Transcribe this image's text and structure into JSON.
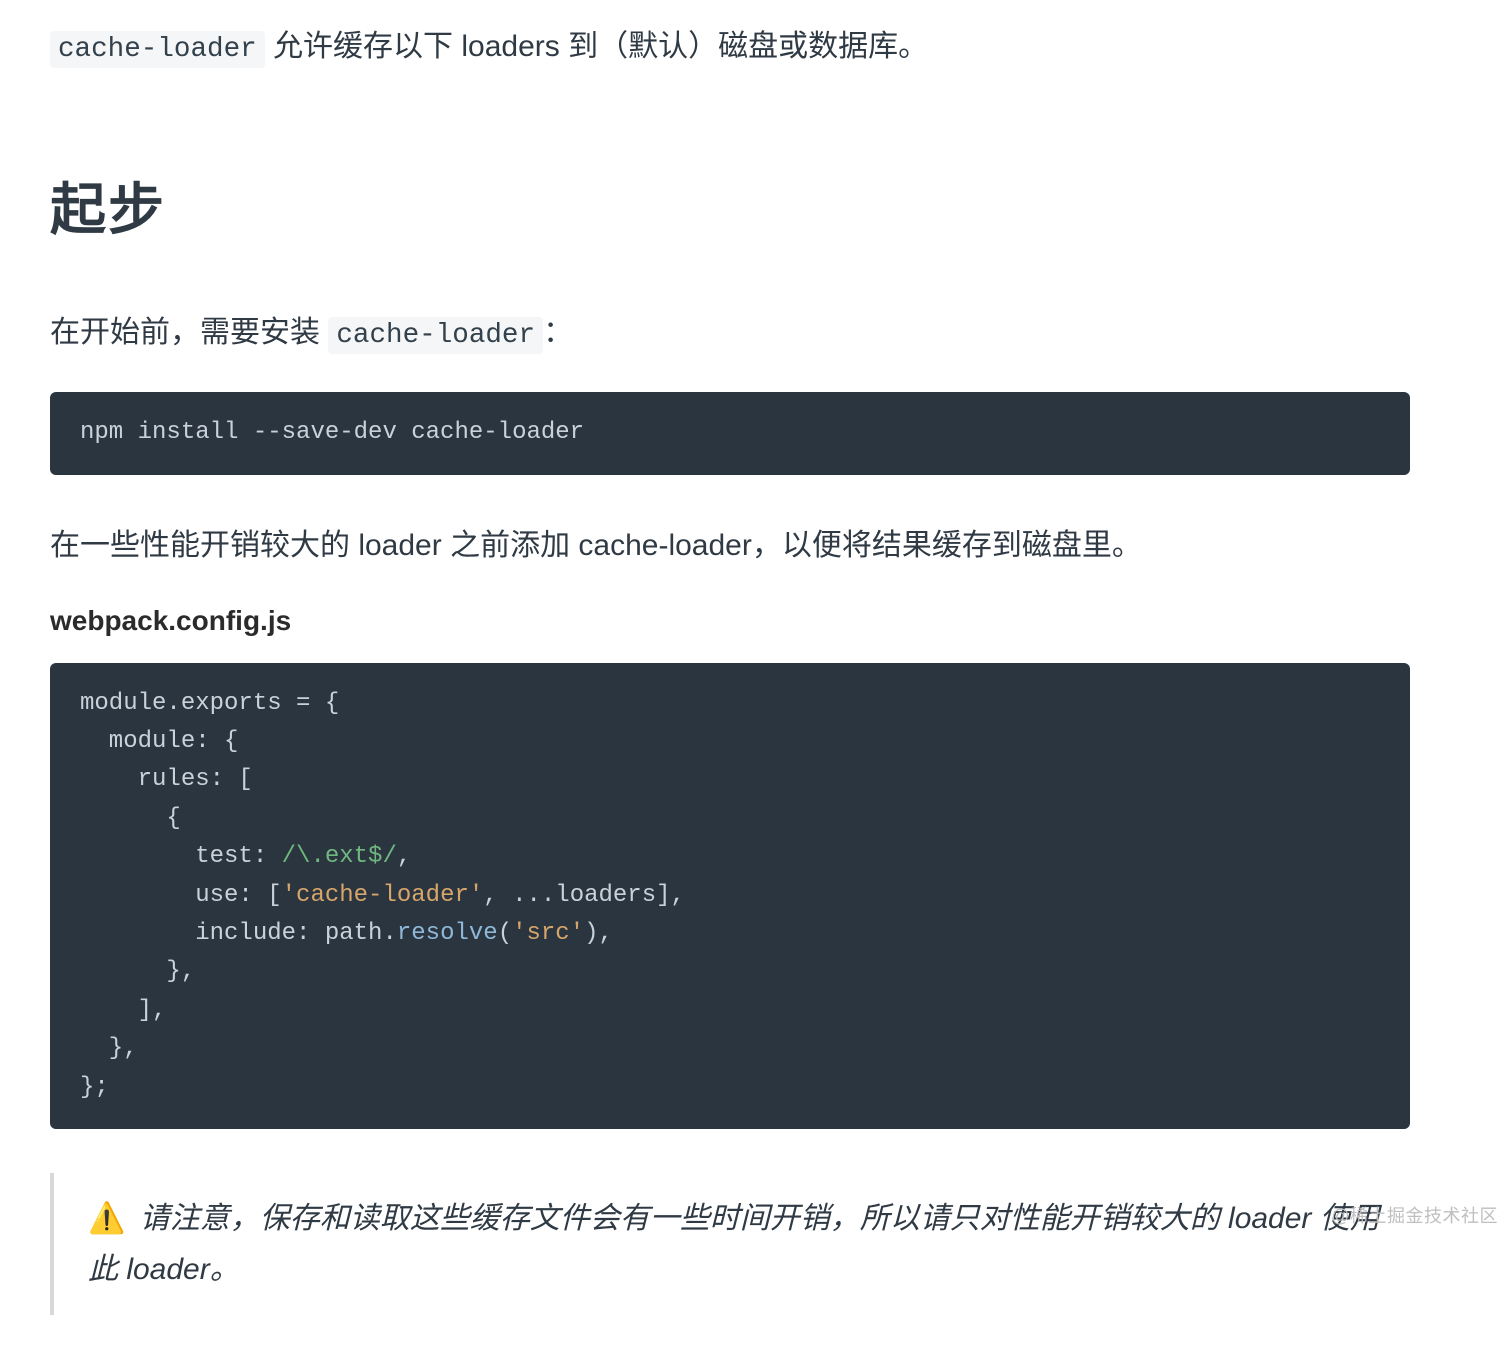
{
  "intro": {
    "code": "cache-loader",
    "rest": " 允许缓存以下 loaders 到（默认）磁盘或数据库。"
  },
  "heading": "起步",
  "before_install": {
    "prefix": "在开始前，需要安装 ",
    "code": "cache-loader",
    "suffix": "："
  },
  "install_cmd": "npm install --save-dev cache-loader",
  "after_install": "在一些性能开销较大的 loader 之前添加 cache-loader，以便将结果缓存到磁盘里。",
  "config_filename": "webpack.config.js",
  "config_code": {
    "l1": "module.exports = {",
    "l2": "  module: {",
    "l3": "    rules: [",
    "l4": "      {",
    "l5a": "        test: ",
    "l5b": "/\\.ext$/",
    "l5c": ",",
    "l6a": "        use: [",
    "l6b": "'cache-loader'",
    "l6c": ", ...loaders],",
    "l7a": "        include: path.",
    "l7b": "resolve",
    "l7c": "(",
    "l7d": "'src'",
    "l7e": "),",
    "l8": "      },",
    "l9": "    ],",
    "l10": "  },",
    "l11": "};"
  },
  "callout": {
    "emoji": "⚠️",
    "text": " 请注意，保存和读取这些缓存文件会有一些时间开销，所以请只对性能开销较大的 loader 使用此 loader。"
  },
  "watermark": "@稀土掘金技术社区"
}
